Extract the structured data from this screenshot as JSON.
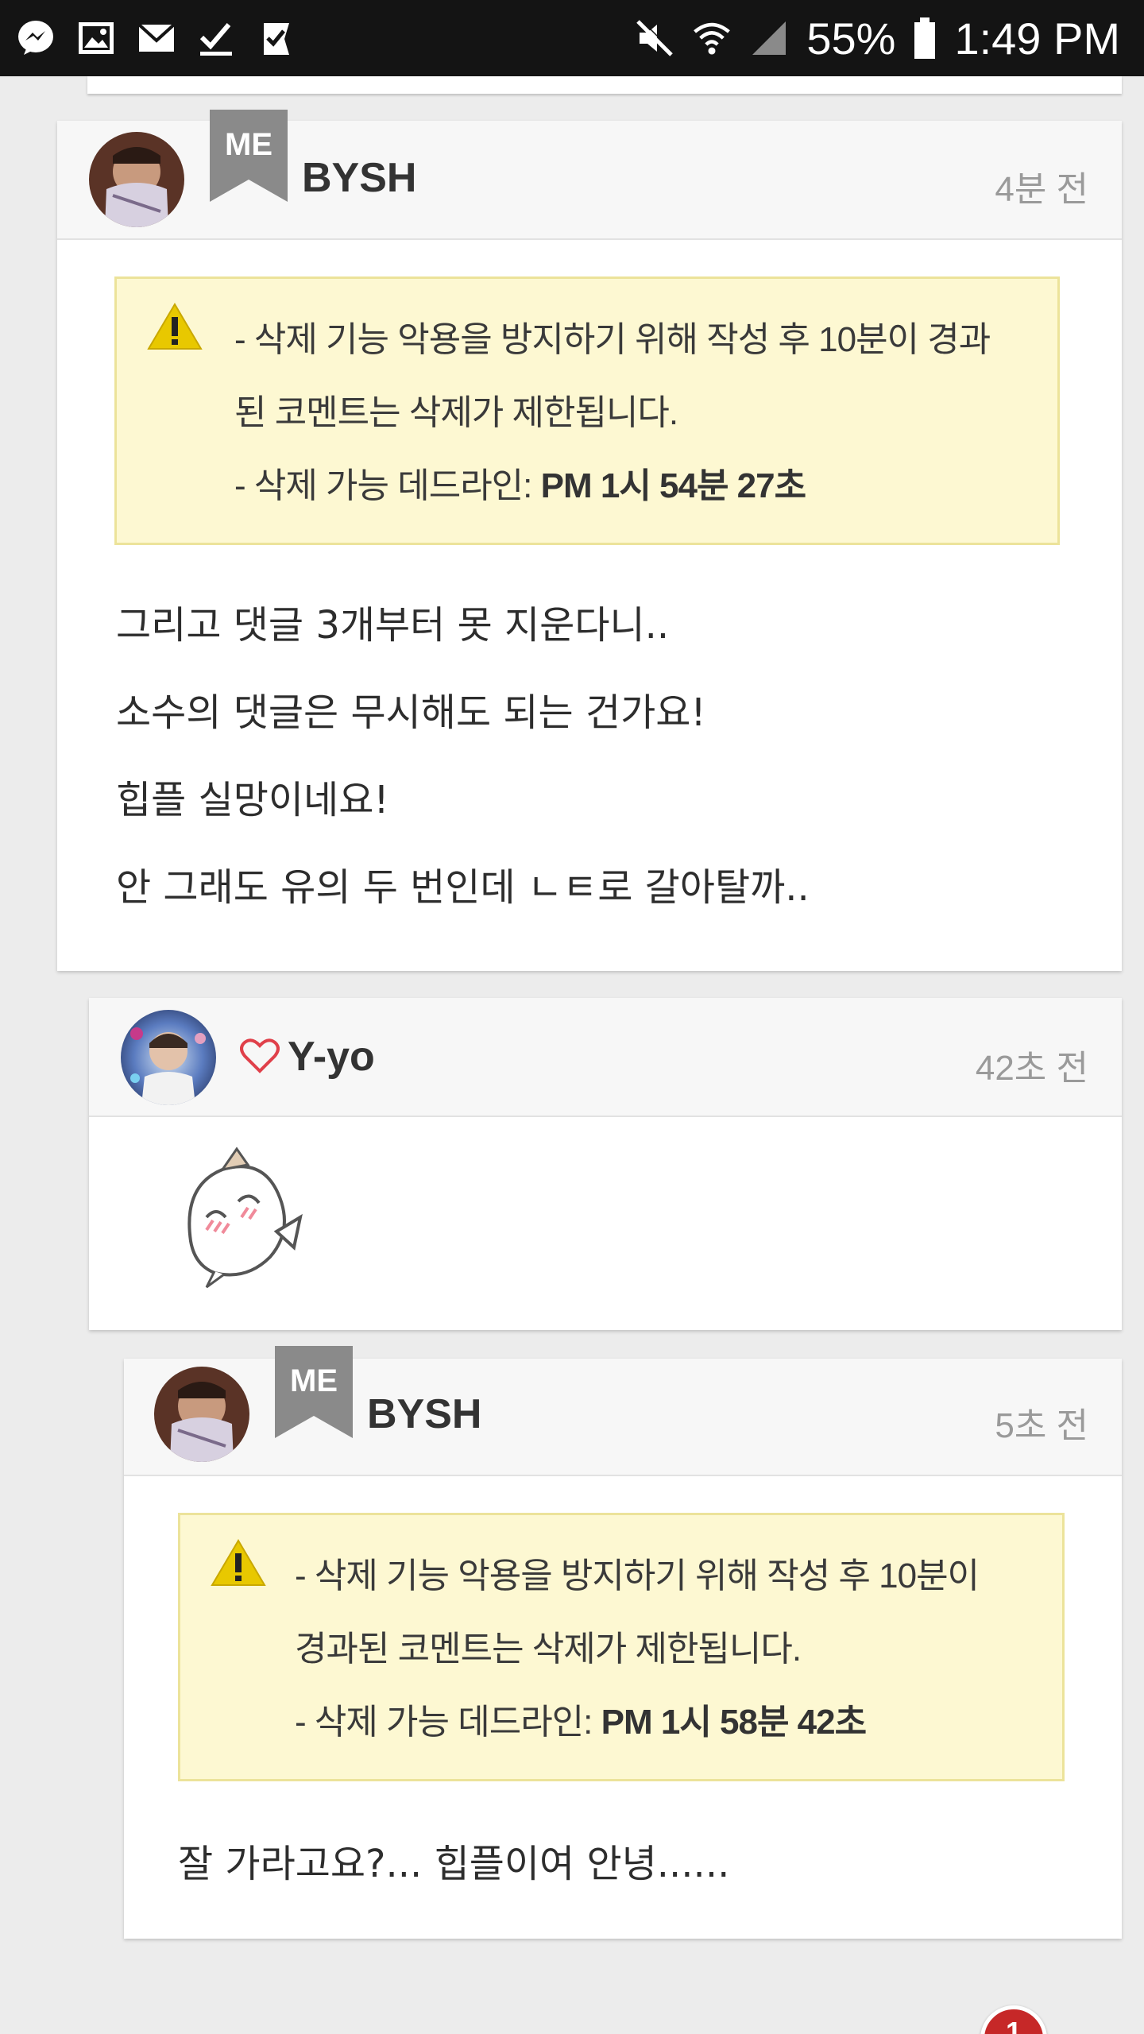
{
  "status_bar": {
    "battery": "55%",
    "time": "1:49 PM",
    "left_icons": [
      "messenger-icon",
      "gallery-icon",
      "mail-icon",
      "check-icon",
      "task-icon"
    ],
    "right_icons": [
      "mute-icon",
      "wifi-icon",
      "signal-icon",
      "battery-icon"
    ]
  },
  "comments": [
    {
      "author": "BYSH",
      "badge": "ME",
      "time": "4분 전",
      "notice": {
        "line1": "- 삭제 기능 악용을 방지하기 위해 작성 후 10분이 경과",
        "line2": "된 코멘트는 삭제가 제한됩니다.",
        "deadline_label": "- 삭제 가능 데드라인: ",
        "deadline_value": "PM 1시 54분 27초"
      },
      "body": [
        "그리고 댓글 3개부터 못 지운다니..",
        "소수의 댓글은 무시해도 되는 건가요!",
        "힙플 실망이네요!",
        "안 그래도 유의 두 번인데 ㄴㅌ로 갈아탈까.."
      ]
    },
    {
      "author": "Y-yo",
      "time": "42초 전",
      "sticker": "sticker-character-blushing"
    },
    {
      "author": "BYSH",
      "badge": "ME",
      "time": "5초 전",
      "notice": {
        "line1": "- 삭제 기능 악용을 방지하기 위해 작성 후 10분이",
        "line2": "경과된 코멘트는 삭제가 제한됩니다.",
        "deadline_label": "- 삭제 가능 데드라인: ",
        "deadline_value": "PM 1시 58분 42초"
      },
      "body": [
        "잘 가라고요?... 힙플이여 안녕......"
      ]
    }
  ],
  "notification_badge": "1",
  "colors": {
    "status_bar": "#141414",
    "notice_bg": "#fdf8d2",
    "notice_border": "#ece39a",
    "me_badge": "#8a8a8a",
    "heart": "#e0404a",
    "notification": "#c62828"
  }
}
